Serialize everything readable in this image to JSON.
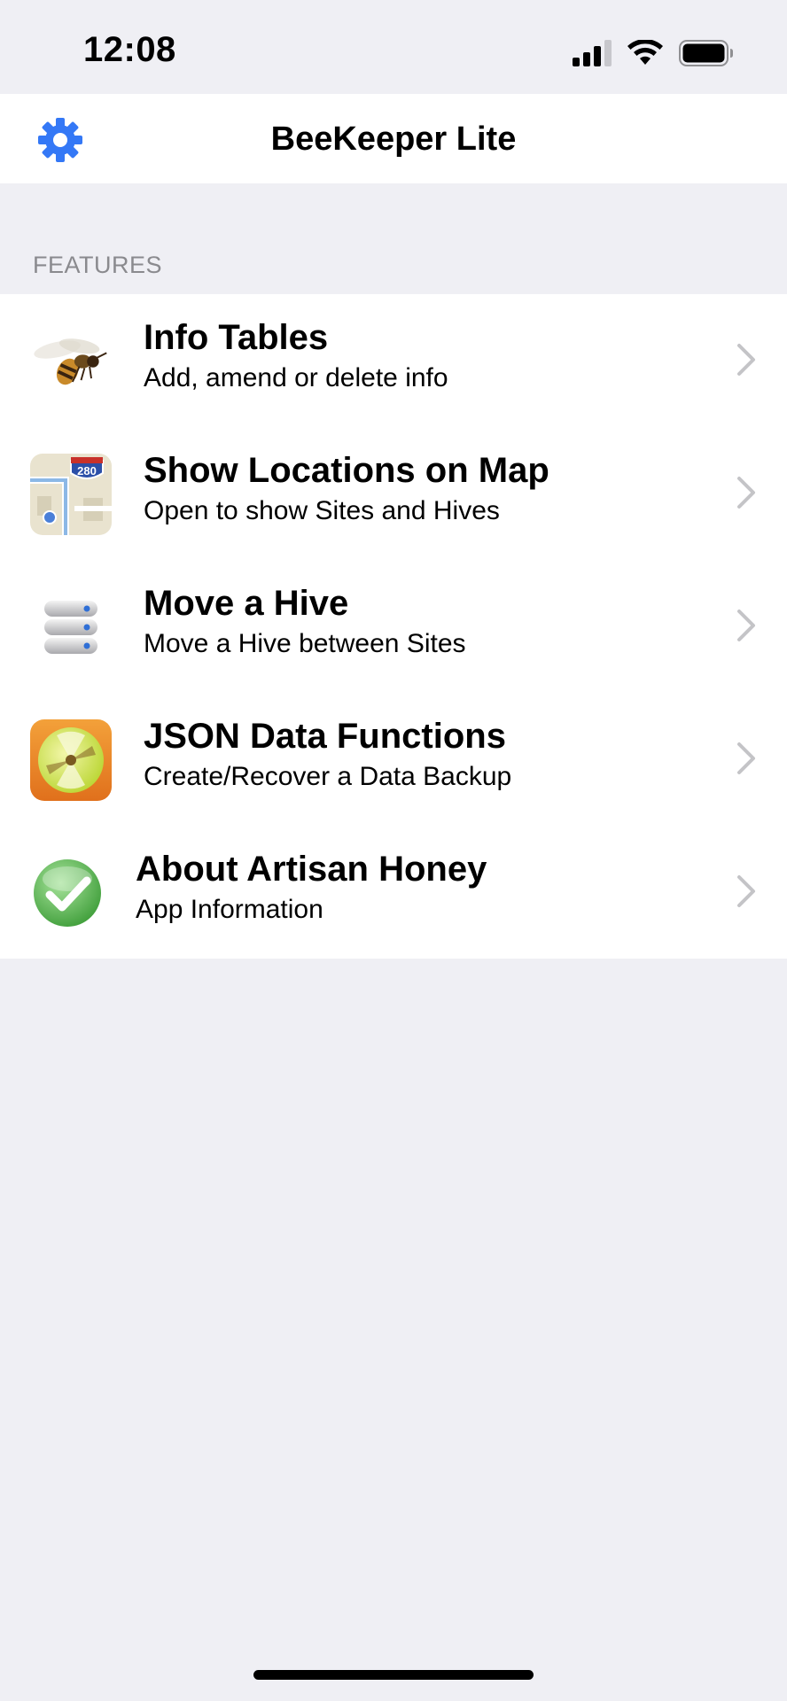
{
  "status_bar": {
    "time": "12:08"
  },
  "nav": {
    "title": "BeeKeeper Lite",
    "settings_icon": "gear-icon"
  },
  "section": {
    "header": "FEATURES"
  },
  "rows": [
    {
      "title": "Info Tables",
      "subtitle": "Add, amend or delete info",
      "icon": "bee-icon"
    },
    {
      "title": "Show Locations on Map",
      "subtitle": "Open to show Sites and Hives",
      "icon": "map-icon"
    },
    {
      "title": "Move a Hive",
      "subtitle": "Move a Hive between Sites",
      "icon": "server-stack-icon"
    },
    {
      "title": "JSON Data Functions",
      "subtitle": "Create/Recover a Data Backup",
      "icon": "disc-backup-icon"
    },
    {
      "title": "About Artisan Honey",
      "subtitle": "App Information",
      "icon": "checkmark-icon"
    }
  ],
  "colors": {
    "accent": "#3478f6",
    "background": "#efeff4",
    "chevron": "#c4c4c7"
  }
}
